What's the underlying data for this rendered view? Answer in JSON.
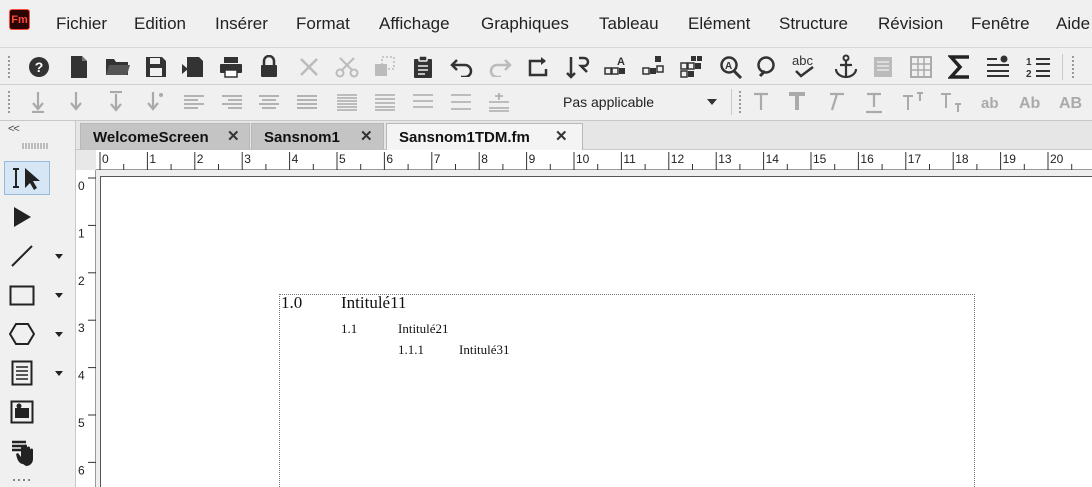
{
  "app": {
    "logo_text": "Fm"
  },
  "menu": [
    "Fichier",
    "Edition",
    "Insérer",
    "Format",
    "Affichage",
    "Graphiques",
    "Tableau",
    "Elément",
    "Structure",
    "Révision",
    "Fenêtre",
    "Aide"
  ],
  "toolbar2": {
    "paragraph_format": "Pas applicable"
  },
  "tabs": [
    {
      "label": "WelcomeScreen",
      "close": "✕"
    },
    {
      "label": "Sansnom1",
      "close": "✕"
    },
    {
      "label": "Sansnom1TDM.fm",
      "close": "✕"
    }
  ],
  "left_panel": {
    "collapse": "<<"
  },
  "ruler": {
    "h_labels": [
      "0",
      "1",
      "2",
      "3",
      "4",
      "5",
      "6",
      "7",
      "8",
      "9",
      "10",
      "11",
      "12",
      "13",
      "14",
      "15",
      "16",
      "17",
      "18",
      "19",
      "20"
    ],
    "v_labels": [
      "0",
      "1",
      "2",
      "3",
      "4",
      "5",
      "6"
    ]
  },
  "document": {
    "lines": [
      {
        "num": "1.0",
        "text": "Intitulé11"
      },
      {
        "num": "1.1",
        "text": "Intitulé21"
      },
      {
        "num": "1.1.1",
        "text": "Intitulé31"
      }
    ]
  },
  "colors": {
    "accent": "#ff4a3d",
    "active_tool": "#d6e6f5"
  }
}
